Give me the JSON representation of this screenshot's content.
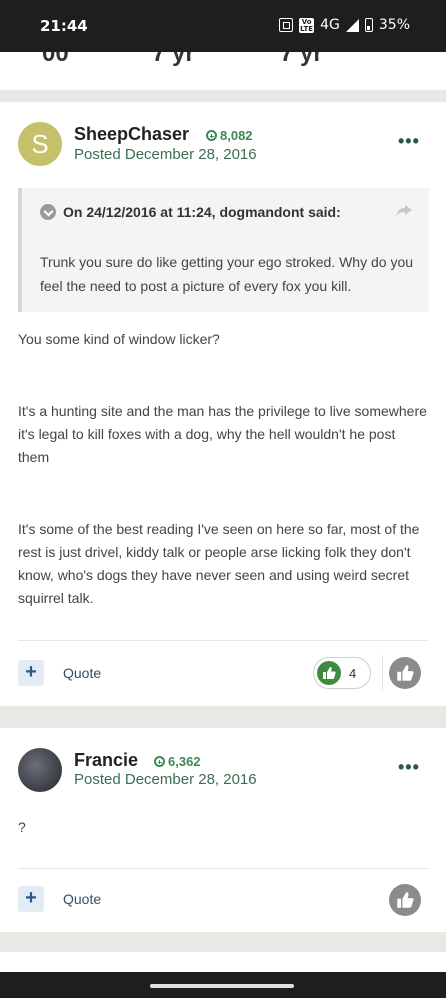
{
  "status_bar": {
    "time": "21:44",
    "network": "4G",
    "battery": "35%",
    "volte_badge": "Vo LTE"
  },
  "top_strip": {
    "values": [
      "00",
      "7 yr",
      "7 yr"
    ]
  },
  "posts": [
    {
      "avatar_letter": "S",
      "author": "SheepChaser",
      "reputation": "8,082",
      "posted": "Posted December 28, 2016",
      "quote": {
        "header": "On 24/12/2016 at 11:24, dogmandont said:",
        "body": "Trunk you sure do like getting your ego stroked. Why do you feel the need to post a picture of every fox you kill."
      },
      "paragraphs": [
        "You some kind of window licker?",
        "It's a hunting site and the man has the privilege to live somewhere it's legal to kill foxes with a dog, why the hell wouldn't he post them",
        "It's some of the best reading I've seen on here so far, most of the rest is just drivel, kiddy talk or people arse licking folk they don't know, who's dogs they have never seen and using weird secret squirrel talk."
      ],
      "actions": {
        "plus": "+",
        "quote": "Quote",
        "like_count": "4"
      }
    },
    {
      "author": "Francie",
      "reputation": "6,362",
      "posted": "Posted December 28, 2016",
      "paragraphs": [
        "?"
      ],
      "actions": {
        "plus": "+",
        "quote": "Quote"
      }
    }
  ],
  "menu_glyph": "•••",
  "colors": {
    "status_bar": "#1e1e1e",
    "separator": "#e9e8e4",
    "reputation": "#3b8a54",
    "like_green": "#3f8a3f",
    "avatar_s": "#c5c069"
  },
  "icons": {
    "quote_toggle": "chevron-down-icon",
    "quote_share": "share-arrow-icon",
    "like": "thumbs-up-icon",
    "menu": "ellipsis-icon"
  }
}
